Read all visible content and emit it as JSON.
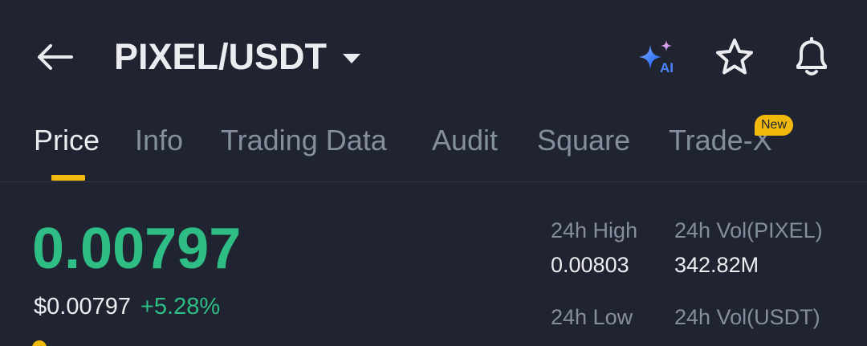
{
  "header": {
    "pair": "PIXEL/USDT",
    "icons": [
      "back-arrow-icon",
      "caret-down-icon",
      "ai-sparkle-icon",
      "star-icon",
      "bell-icon"
    ],
    "ai_label": "AI"
  },
  "tabs": [
    {
      "label": "Price",
      "active": true
    },
    {
      "label": "Info"
    },
    {
      "label": "Trading Data"
    },
    {
      "label": "Audit"
    },
    {
      "label": "Square"
    },
    {
      "label": "Trade-X",
      "badge": "New"
    }
  ],
  "price": {
    "last": "0.00797",
    "usd": "$0.00797",
    "change": "+5.28%"
  },
  "stats": {
    "high_label": "24h High",
    "high_value": "0.00803",
    "vol_base_label": "24h Vol(PIXEL)",
    "vol_base_value": "342.82M",
    "low_label": "24h Low",
    "vol_quote_label": "24h Vol(USDT)"
  },
  "colors": {
    "background": "#202430",
    "accent": "#F0B90B",
    "up": "#2EBD85",
    "text_primary": "#EAECEF",
    "text_secondary": "#848E9C"
  }
}
